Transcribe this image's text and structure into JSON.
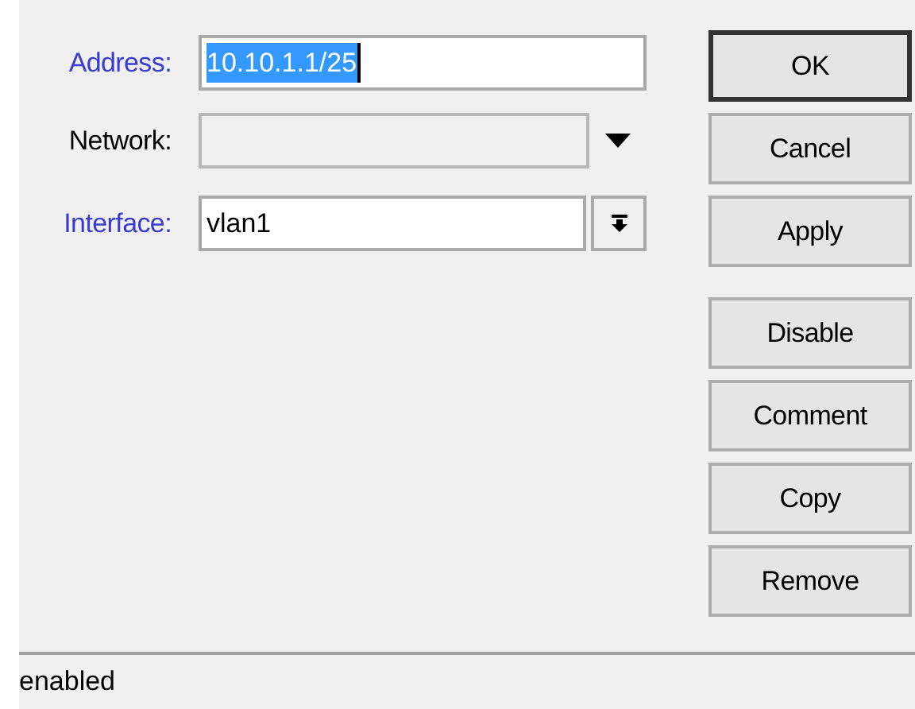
{
  "fields": [
    {
      "kind": "text",
      "label": "Address:",
      "label_emphasized": true,
      "value": "10.10.1.1/25",
      "value_selected": true,
      "disabled": false
    },
    {
      "kind": "dropdown",
      "label": "Network:",
      "label_emphasized": false,
      "disabled": true
    },
    {
      "kind": "combo",
      "label": "Interface:",
      "label_emphasized": true,
      "value": "vlan1",
      "value_selected": false,
      "disabled": false
    }
  ],
  "button_groups": [
    {
      "buttons": [
        {
          "label": "OK",
          "default": true
        },
        {
          "label": "Cancel",
          "default": false
        },
        {
          "label": "Apply",
          "default": false
        }
      ]
    },
    {
      "buttons": [
        {
          "label": "Disable",
          "default": false
        },
        {
          "label": "Comment",
          "default": false
        },
        {
          "label": "Copy",
          "default": false
        },
        {
          "label": "Remove",
          "default": false
        }
      ]
    }
  ],
  "status_bar": {
    "text": "enabled"
  }
}
